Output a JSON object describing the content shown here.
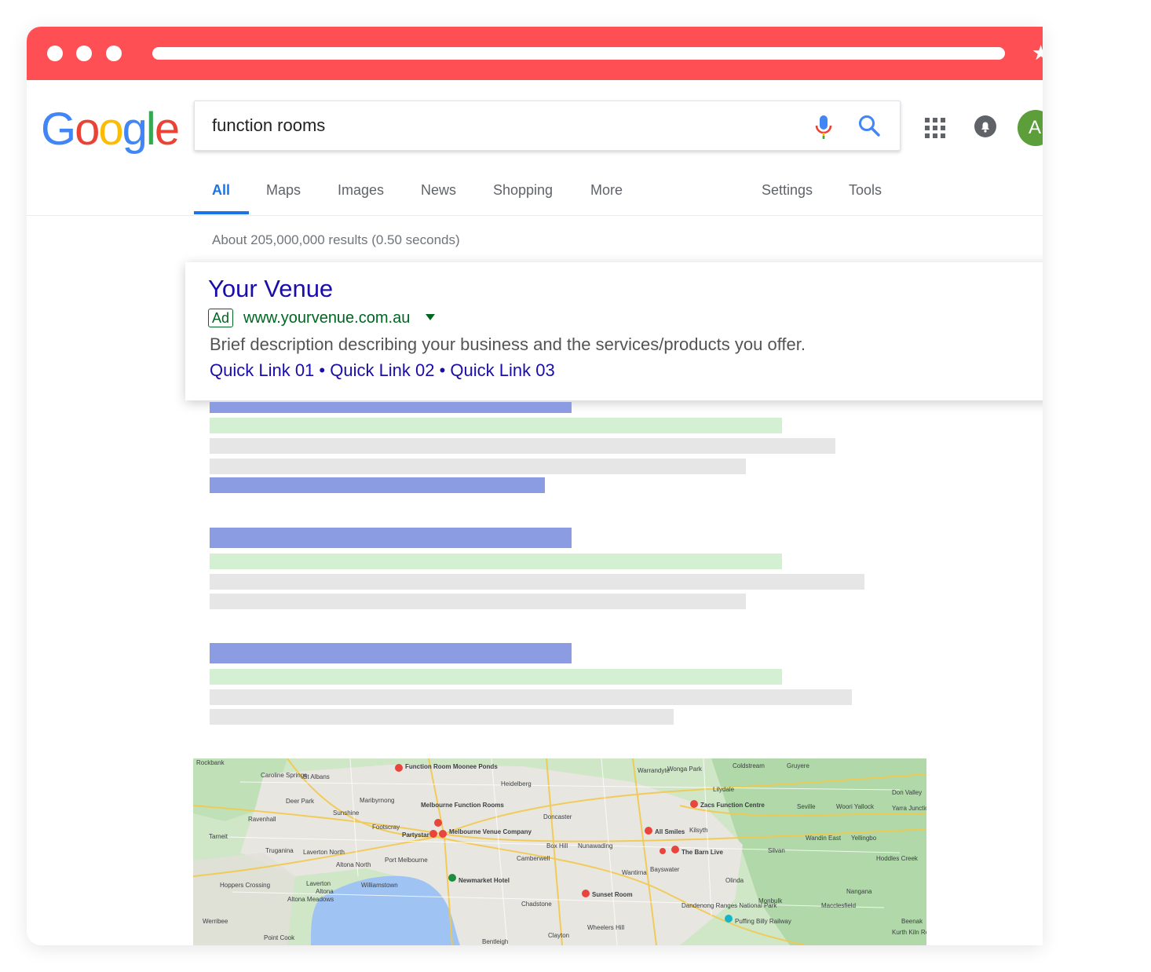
{
  "browser": {
    "window_controls": [
      "close",
      "minimize",
      "maximize"
    ],
    "bookmark_glyph": "★"
  },
  "header": {
    "logo": {
      "letters": [
        "G",
        "o",
        "o",
        "g",
        "l",
        "e"
      ],
      "colors": [
        "#4285f4",
        "#ea4335",
        "#fbbc05",
        "#4285f4",
        "#34a853",
        "#ea4335"
      ]
    },
    "search": {
      "query": "function rooms"
    },
    "avatar_initial": "A"
  },
  "tabs": [
    {
      "label": "All",
      "active": true
    },
    {
      "label": "Maps"
    },
    {
      "label": "Images"
    },
    {
      "label": "News"
    },
    {
      "label": "Shopping"
    },
    {
      "label": "More"
    },
    {
      "label": "Settings"
    },
    {
      "label": "Tools"
    }
  ],
  "results_count": "About 205,000,000 results (0.50 seconds)",
  "ad": {
    "title": "Your Venue",
    "badge": "Ad",
    "url": "www.yourvenue.com.au",
    "description": "Brief description describing your business and the services/products you offer.",
    "links": "Quick Link 01 • Quick Link 02 • Quick Link 03"
  },
  "map": {
    "places": [
      "Rockbank",
      "Caroline Springs",
      "St Albans",
      "Function Room Moonee Ponds",
      "Heidelberg",
      "Warrandyte",
      "Wonga Park",
      "Coldstream",
      "Gruyere",
      "Deer Park",
      "Maribyrnong",
      "Sunshine",
      "Footscray",
      "Melbourne Function Rooms",
      "Partystar",
      "Melbourne Venue Company",
      "Doncaster",
      "Zacs Function Centre",
      "Seville",
      "Woori Yallock",
      "Yarra Junction",
      "Don Valley",
      "Lilydale",
      "Ravenhall",
      "Tarneit",
      "Truganina",
      "Laverton North",
      "Port Melbourne",
      "Camberwell",
      "Box Hill",
      "Nunawading",
      "All Smiles",
      "Kilsyth",
      "The Barn Live",
      "Wandin East",
      "Yellingbo",
      "Silvan",
      "Hoddles Creek",
      "Altona North",
      "Newmarket Hotel",
      "Bayswater",
      "Wantirna",
      "Olinda",
      "Williamstown",
      "Laverton",
      "Altona",
      "Altona Meadows",
      "Hoppers Crossing",
      "Werribee",
      "Sunset Room",
      "Chadstone",
      "Monbulk",
      "Macclesfield",
      "Nangana",
      "Dandenong Ranges National Park",
      "Puffing Billy Railway",
      "Point Cook",
      "Clayton",
      "Wheelers Hill",
      "Bentleigh",
      "Beenak",
      "Kurth Kiln Regional Park"
    ]
  }
}
